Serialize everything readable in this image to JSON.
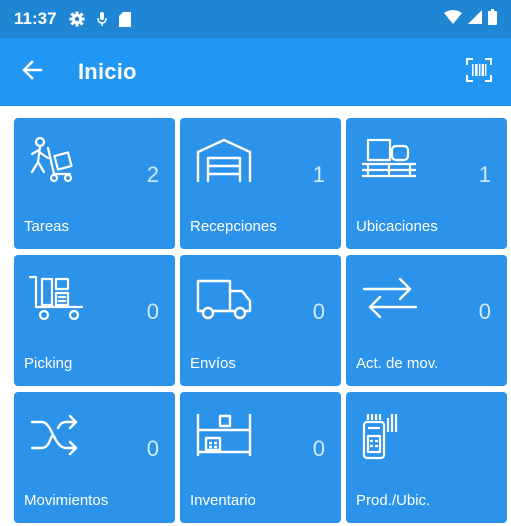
{
  "status_bar": {
    "time": "11:37",
    "icons": [
      "gear-icon",
      "mic-icon",
      "sd-card-icon",
      "wifi-icon",
      "signal-icon",
      "battery-icon"
    ]
  },
  "app_bar": {
    "title": "Inicio",
    "back_icon": "arrow-left-icon",
    "scan_icon": "barcode-scan-icon"
  },
  "colors": {
    "status_bar": "#1f86d6",
    "app_bar": "#2196f3",
    "tile": "#2c93ea",
    "count_text": "#d4e9fb"
  },
  "tiles": [
    {
      "label": "Tareas",
      "count": "2",
      "icon": "worker-dolly-icon"
    },
    {
      "label": "Recepciones",
      "count": "1",
      "icon": "warehouse-icon"
    },
    {
      "label": "Ubicaciones",
      "count": "1",
      "icon": "pallet-boxes-icon"
    },
    {
      "label": "Picking",
      "count": "0",
      "icon": "cart-boxes-icon"
    },
    {
      "label": "Envíos",
      "count": "0",
      "icon": "truck-icon"
    },
    {
      "label": "Act. de mov.",
      "count": "0",
      "icon": "swap-arrows-icon"
    },
    {
      "label": "Movimientos",
      "count": "0",
      "icon": "shuffle-icon"
    },
    {
      "label": "Inventario",
      "count": "0",
      "icon": "shelf-boxes-icon"
    },
    {
      "label": "Prod./Ubic.",
      "count": "",
      "icon": "scanner-device-icon"
    }
  ]
}
